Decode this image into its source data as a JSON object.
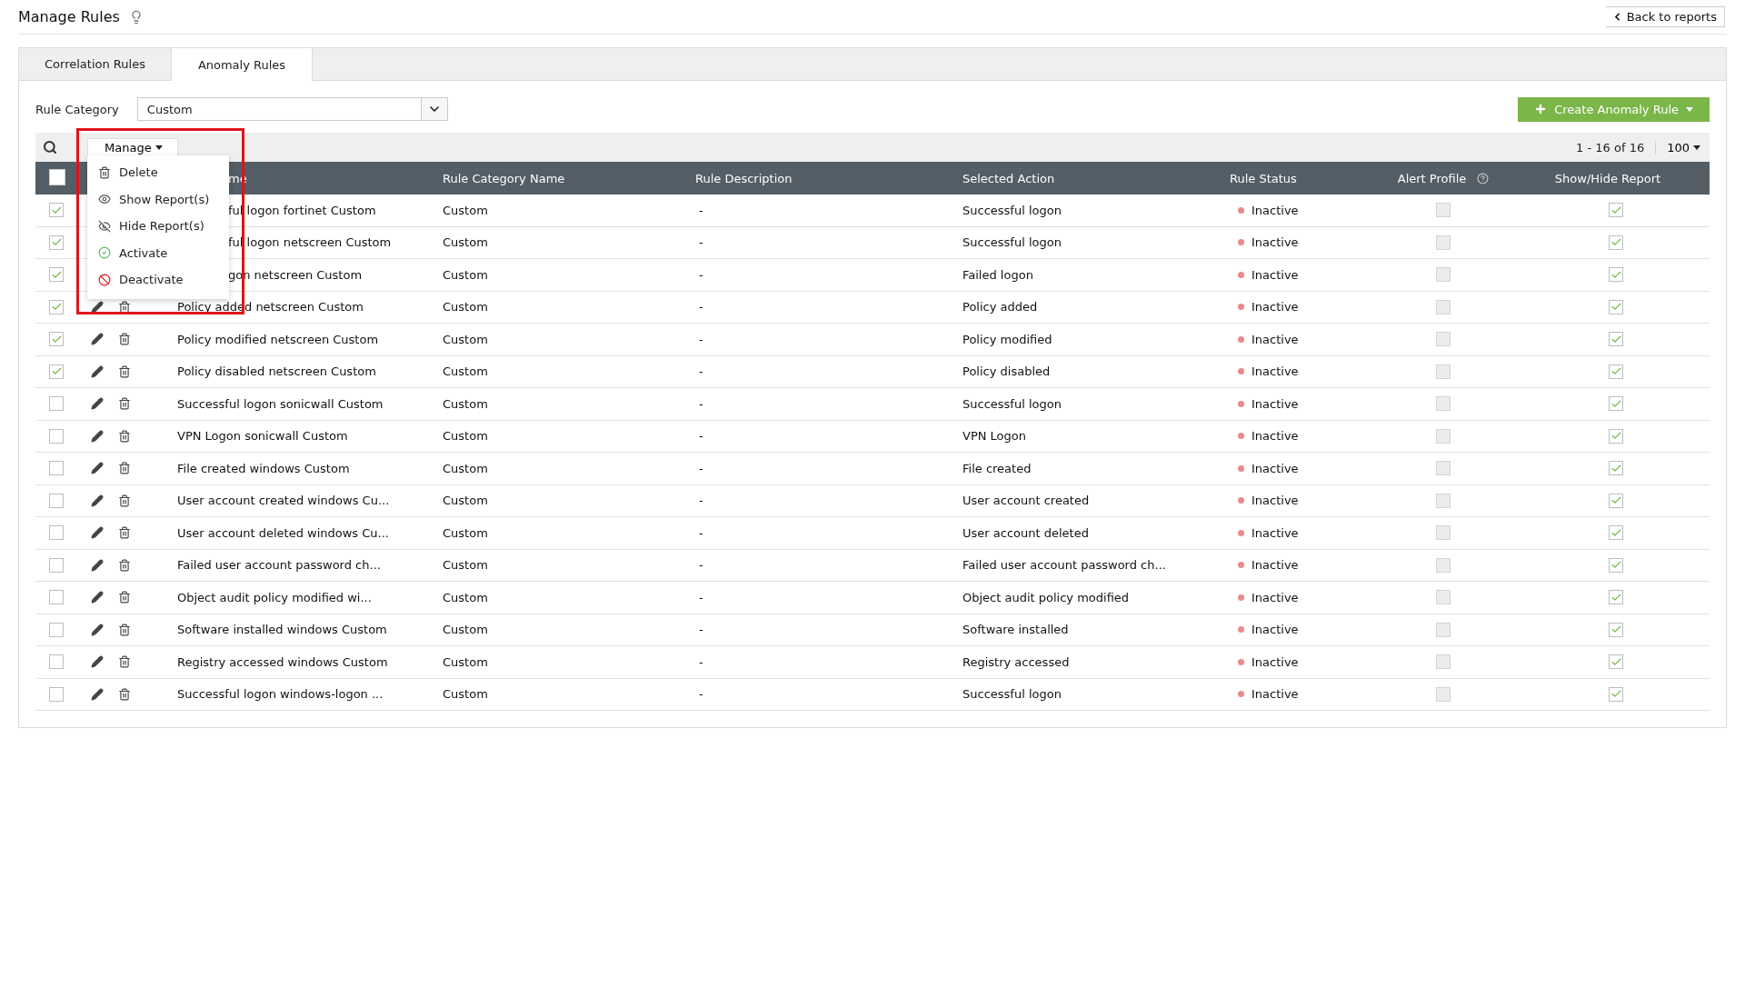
{
  "page": {
    "title": "Manage Rules",
    "back_link": "Back to reports"
  },
  "tabs": [
    {
      "label": "Correlation Rules",
      "selected": false
    },
    {
      "label": "Anomaly Rules",
      "selected": true
    }
  ],
  "filter": {
    "label": "Rule Category",
    "value": "Custom"
  },
  "create_button": {
    "label": "Create Anomaly Rule"
  },
  "toolbar": {
    "pagination": "1 - 16 of 16",
    "page_size": "100"
  },
  "manage_menu": {
    "label": "Manage",
    "expanded": true,
    "items": [
      {
        "label": "Delete",
        "kind": "delete"
      },
      {
        "label": "Show Report(s)",
        "kind": "show"
      },
      {
        "label": "Hide Report(s)",
        "kind": "hide"
      },
      {
        "label": "Activate",
        "kind": "activate"
      },
      {
        "label": "Deactivate",
        "kind": "deactivate"
      }
    ]
  },
  "table": {
    "select_all": false,
    "columns": [
      {
        "label": "me",
        "covered": true
      },
      {
        "label": "Rule Category Name"
      },
      {
        "label": "Rule Description"
      },
      {
        "label": "Selected Action"
      },
      {
        "label": "Rule Status"
      },
      {
        "label": "Alert Profile",
        "help": true
      },
      {
        "label": "Show/Hide Report"
      }
    ],
    "rows": [
      {
        "name": "ful logon fortinet Custom",
        "covered": true,
        "category": "Custom",
        "description": "-",
        "action": "Successful logon",
        "status": "Inactive",
        "active": false,
        "alert_profile": false,
        "show_report": true,
        "selected": true
      },
      {
        "name": "ful logon netscreen Custom",
        "covered": true,
        "category": "Custom",
        "description": "-",
        "action": "Successful logon",
        "status": "Inactive",
        "active": false,
        "alert_profile": false,
        "show_report": true,
        "selected": true
      },
      {
        "name": "gon netscreen Custom",
        "covered": true,
        "category": "Custom",
        "description": "-",
        "action": "Failed logon",
        "status": "Inactive",
        "active": false,
        "alert_profile": false,
        "show_report": true,
        "selected": true
      },
      {
        "name": "Policy added netscreen Custom",
        "covered": false,
        "category": "Custom",
        "description": "-",
        "action": "Policy added",
        "status": "Inactive",
        "active": false,
        "alert_profile": false,
        "show_report": true,
        "selected": true
      },
      {
        "name": "Policy modified netscreen Custom",
        "covered": false,
        "category": "Custom",
        "description": "-",
        "action": "Policy modified",
        "status": "Inactive",
        "active": false,
        "alert_profile": false,
        "show_report": true,
        "selected": true
      },
      {
        "name": "Policy disabled netscreen Custom",
        "covered": false,
        "category": "Custom",
        "description": "-",
        "action": "Policy disabled",
        "status": "Inactive",
        "active": false,
        "alert_profile": false,
        "show_report": true,
        "selected": true
      },
      {
        "name": "Successful logon sonicwall Custom",
        "covered": false,
        "category": "Custom",
        "description": "-",
        "action": "Successful logon",
        "status": "Inactive",
        "active": false,
        "alert_profile": false,
        "show_report": true,
        "selected": false
      },
      {
        "name": "VPN Logon sonicwall Custom",
        "covered": false,
        "category": "Custom",
        "description": "-",
        "action": "VPN Logon",
        "status": "Inactive",
        "active": false,
        "alert_profile": false,
        "show_report": true,
        "selected": false
      },
      {
        "name": "File created windows Custom",
        "covered": false,
        "category": "Custom",
        "description": "-",
        "action": "File created",
        "status": "Inactive",
        "active": false,
        "alert_profile": false,
        "show_report": true,
        "selected": false
      },
      {
        "name": "User account created windows Cu...",
        "covered": false,
        "category": "Custom",
        "description": "-",
        "action": "User account created",
        "status": "Inactive",
        "active": false,
        "alert_profile": false,
        "show_report": true,
        "selected": false
      },
      {
        "name": "User account deleted windows Cu...",
        "covered": false,
        "category": "Custom",
        "description": "-",
        "action": "User account deleted",
        "status": "Inactive",
        "active": false,
        "alert_profile": false,
        "show_report": true,
        "selected": false
      },
      {
        "name": "Failed user account password ch...",
        "covered": false,
        "category": "Custom",
        "description": "-",
        "action": "Failed user account password ch...",
        "status": "Inactive",
        "active": false,
        "alert_profile": false,
        "show_report": true,
        "selected": false
      },
      {
        "name": "Object audit policy modified wi...",
        "covered": false,
        "category": "Custom",
        "description": "-",
        "action": "Object audit policy modified",
        "status": "Inactive",
        "active": false,
        "alert_profile": false,
        "show_report": true,
        "selected": false
      },
      {
        "name": "Software installed windows Custom",
        "covered": false,
        "category": "Custom",
        "description": "-",
        "action": "Software installed",
        "status": "Inactive",
        "active": false,
        "alert_profile": false,
        "show_report": true,
        "selected": false
      },
      {
        "name": "Registry accessed windows Custom",
        "covered": false,
        "category": "Custom",
        "description": "-",
        "action": "Registry accessed",
        "status": "Inactive",
        "active": false,
        "alert_profile": false,
        "show_report": true,
        "selected": false
      },
      {
        "name": "Successful logon windows-logon ...",
        "covered": false,
        "category": "Custom",
        "description": "-",
        "action": "Successful logon",
        "status": "Inactive",
        "active": false,
        "alert_profile": false,
        "show_report": true,
        "selected": false
      }
    ]
  }
}
